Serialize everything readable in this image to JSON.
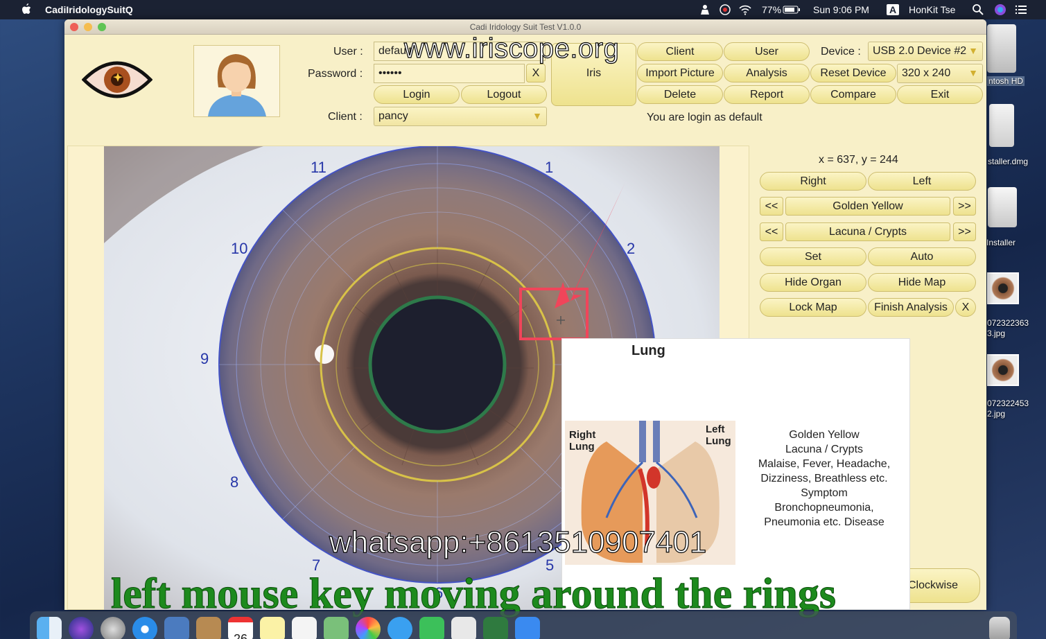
{
  "menubar": {
    "app_name": "CadiIridologySuitQ",
    "battery": "77%",
    "datetime": "Sun 9:06 PM",
    "input_source": "A",
    "user": "HonKit Tse"
  },
  "desktop": {
    "icons": [
      {
        "name": "macintosh-hd",
        "label": "ntosh HD"
      },
      {
        "name": "installer-dmg",
        "label": "staller.dmg"
      },
      {
        "name": "installer",
        "label": "Installer"
      },
      {
        "name": "iris-photo-1",
        "label": "072322363\n3.jpg"
      },
      {
        "name": "iris-photo-2",
        "label": "072322453\n2.jpg"
      }
    ]
  },
  "window": {
    "title": "Cadi Iridology Suit Test V1.0.0",
    "login": {
      "user_label": "User :",
      "user_value": "default",
      "password_label": "Password :",
      "password_value": "••••••",
      "clear_label": "X",
      "login_label": "Login",
      "logout_label": "Logout",
      "client_label": "Client :",
      "client_value": "pancy"
    },
    "toolbar": {
      "iris": "Iris",
      "client": "Client",
      "user": "User",
      "import_picture": "Import Picture",
      "analysis": "Analysis",
      "delete": "Delete",
      "report": "Report",
      "reset_device": "Reset Device",
      "compare": "Compare",
      "exit": "Exit",
      "device_label": "Device :",
      "device_value": "USB 2.0 Device #2",
      "resolution_value": "320 x 240",
      "status": "You are login as default"
    },
    "clock_numbers": [
      "11",
      "1",
      "10",
      "2",
      "9",
      "8",
      "7",
      "5",
      "6"
    ],
    "controls": {
      "coords": "x = 637, y = 244",
      "right": "Right",
      "left": "Left",
      "prev": "<<",
      "next": ">>",
      "color_value": "Golden Yellow",
      "sign_value": "Lacuna / Crypts",
      "set": "Set",
      "auto": "Auto",
      "hide_organ": "Hide Organ",
      "hide_map": "Hide Map",
      "lock_map": "Lock Map",
      "finish_analysis": "Finish Analysis",
      "close": "X",
      "clockwise": "Clockwise"
    },
    "popup": {
      "title": "Lung",
      "right_lung": "Right\nLung",
      "left_lung": "Left\nLung",
      "lines": [
        "Golden Yellow",
        "Lacuna / Crypts",
        "Malaise, Fever, Headache,",
        "Dizziness, Breathless etc.",
        "Symptom",
        "Bronchopneumonia,",
        "Pneumonia etc. Disease"
      ]
    }
  },
  "overlays": {
    "url": "www.iriscope.org",
    "whatsapp": "whatsapp:+8613510907401",
    "caption": "left mouse key moving around the rings"
  },
  "dock": {
    "calendar_day": "26"
  }
}
